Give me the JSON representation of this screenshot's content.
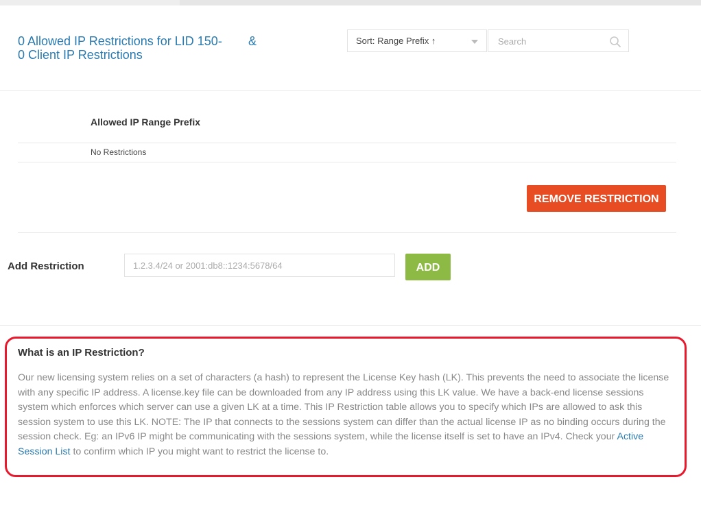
{
  "header": {
    "title_line1": "0 Allowed IP Restrictions for LID 150-",
    "amp": "&",
    "title_line2": "0 Client IP Restrictions"
  },
  "toolbar": {
    "sort_label": "Sort: Range Prefix ↑",
    "search_placeholder": "Search"
  },
  "table": {
    "column_header": "Allowed IP Range Prefix",
    "empty_text": "No Restrictions"
  },
  "actions": {
    "remove_label": "REMOVE RESTRICTION"
  },
  "add_form": {
    "label": "Add Restriction",
    "placeholder": "1.2.3.4/24 or 2001:db8::1234:5678/64",
    "add_label": "ADD"
  },
  "info": {
    "title": "What is an IP Restriction?",
    "body_before_link": "Our new licensing system relies on a set of characters (a hash) to represent the License Key hash (LK). This prevents the need to associate the license with any specific IP address. A license.key file can be downloaded from any IP address using this LK value. We have a back-end license sessions system which enforces which server can use a given LK at a time. This IP Restriction table allows you to specify which IPs are allowed to ask this session system to use this LK. NOTE: The IP that connects to the sessions system can differ than the actual license IP as no binding occurs during the session check. Eg: an IPv6 IP might be communicating with the sessions system, while the license itself is set to have an IPv4. Check your ",
    "link_text": "Active Session List",
    "body_after_link": " to confirm which IP you might want to restrict the license to."
  },
  "colors": {
    "link_blue": "#2a7ab0",
    "remove_orange": "#e84c22",
    "add_green": "#8dba44",
    "highlight_red": "#e8192c"
  },
  "icons": {
    "search": "search-icon",
    "sort_caret": "chevron-down-icon"
  }
}
